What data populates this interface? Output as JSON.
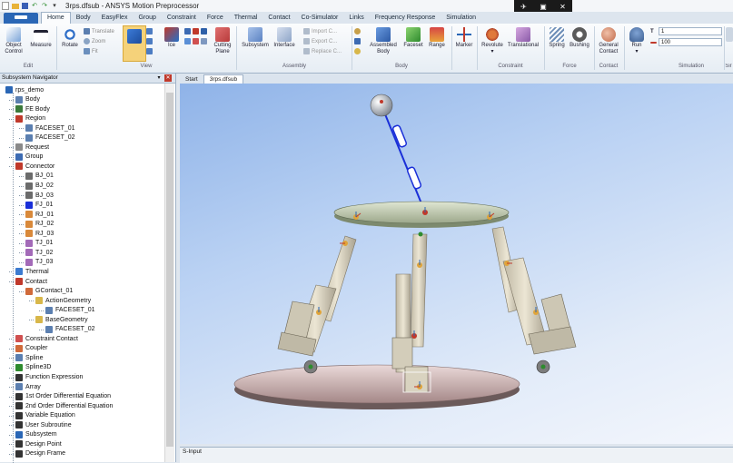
{
  "window": {
    "title": "3rps.dfsub - ANSYS Motion Preprocessor"
  },
  "tabs": {
    "file": "",
    "items": [
      "Home",
      "Body",
      "EasyFlex",
      "Group",
      "Constraint",
      "Force",
      "Thermal",
      "Contact",
      "Co-Simulator",
      "Links",
      "Frequency Response",
      "Simulation"
    ]
  },
  "ribbon": {
    "object_control": "Object Control",
    "measure": "Measure",
    "rotate": "Rotate",
    "translate": "Translate",
    "zoom": "Zoom",
    "fit": "Fit",
    "ice": "Ice",
    "cutting_plane": "Cutting Plane",
    "subsystem": "Subsystem",
    "interface": "Interface",
    "import_c": "Import C...",
    "export_c": "Export C...",
    "replace_c": "Replace C...",
    "assembled_body": "Assembled Body",
    "faceset": "Faceset",
    "range": "Range",
    "marker": "Marker",
    "revolute": "Revolute",
    "translational": "Translational",
    "spring": "Spring",
    "bushing": "Bushing",
    "general_contact": "General Contact",
    "run": "Run",
    "end_time": "1",
    "steps": "100",
    "groups": {
      "edit": "Edit",
      "view": "View",
      "assembly": "Assembly",
      "body": "Body",
      "constraint": "Constraint",
      "force": "Force",
      "contact": "Contact",
      "simulation": "Simulation",
      "cut": "Sir"
    }
  },
  "navigator": {
    "title": "Subsystem Navigator",
    "items": [
      {
        "label": "rps_demo"
      },
      {
        "label": "Body"
      },
      {
        "label": "FE Body"
      },
      {
        "label": "Region"
      },
      {
        "label": "FACESET_01"
      },
      {
        "label": "FACESET_02"
      },
      {
        "label": "Request"
      },
      {
        "label": "Group"
      },
      {
        "label": "Connector"
      },
      {
        "label": "BJ_01"
      },
      {
        "label": "BJ_02"
      },
      {
        "label": "BJ_03"
      },
      {
        "label": "FJ_01"
      },
      {
        "label": "RJ_01"
      },
      {
        "label": "RJ_02"
      },
      {
        "label": "RJ_03"
      },
      {
        "label": "TJ_01"
      },
      {
        "label": "TJ_02"
      },
      {
        "label": "TJ_03"
      },
      {
        "label": "Thermal"
      },
      {
        "label": "Contact"
      },
      {
        "label": "GContact_01"
      },
      {
        "label": "ActionGeometry"
      },
      {
        "label": "FACESET_01"
      },
      {
        "label": "BaseGeometry"
      },
      {
        "label": "FACESET_02"
      },
      {
        "label": "Constraint Contact"
      },
      {
        "label": "Coupler"
      },
      {
        "label": "Spline"
      },
      {
        "label": "Spline3D"
      },
      {
        "label": "Function Expression"
      },
      {
        "label": "Array"
      },
      {
        "label": "1st Order Differential Equation"
      },
      {
        "label": "2nd Order Differential Equation"
      },
      {
        "label": "Variable Equation"
      },
      {
        "label": "User Subroutine"
      },
      {
        "label": "Subsystem"
      },
      {
        "label": "Design Point"
      },
      {
        "label": "Design Frame"
      }
    ]
  },
  "doc_tabs": [
    "Start",
    "3rps.dfsub"
  ],
  "sinput": {
    "label": "S-Input"
  },
  "colors": {
    "accent": "#2a66b5",
    "viewport_top": "#8fb3e8",
    "platform": "#c3ccb8",
    "leg": "#d6d0bf",
    "link": "#1a2fd8"
  }
}
